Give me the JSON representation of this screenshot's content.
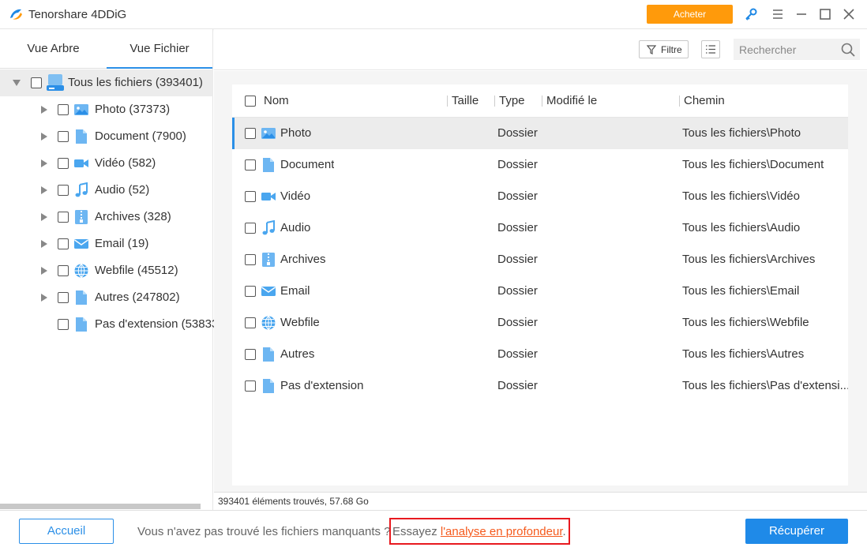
{
  "app": {
    "title": "Tenorshare 4DDiG",
    "buy_label": "Acheter"
  },
  "left": {
    "tabs": [
      {
        "label": "Vue Arbre"
      },
      {
        "label": "Vue Fichier"
      }
    ],
    "root": {
      "label": "Tous les fichiers (393401)"
    },
    "items": [
      {
        "label": "Photo (37373)",
        "icon": "image-icon"
      },
      {
        "label": "Document (7900)",
        "icon": "document-icon"
      },
      {
        "label": "Vidéo (582)",
        "icon": "video-icon"
      },
      {
        "label": "Audio (52)",
        "icon": "music-icon"
      },
      {
        "label": "Archives (328)",
        "icon": "archive-icon"
      },
      {
        "label": "Email (19)",
        "icon": "mail-icon"
      },
      {
        "label": "Webfile (45512)",
        "icon": "globe-icon"
      },
      {
        "label": "Autres (247802)",
        "icon": "document-icon"
      },
      {
        "label": "Pas d'extension (53833",
        "icon": "document-icon"
      }
    ]
  },
  "toolbar": {
    "filter_label": "Filtre",
    "search_placeholder": "Rechercher"
  },
  "table": {
    "columns": {
      "name": "Nom",
      "size": "Taille",
      "type": "Type",
      "modified": "Modifié le",
      "path": "Chemin"
    },
    "rows": [
      {
        "name": "Photo",
        "type": "Dossier",
        "path": "Tous les fichiers\\Photo",
        "icon": "image-icon"
      },
      {
        "name": "Document",
        "type": "Dossier",
        "path": "Tous les fichiers\\Document",
        "icon": "document-icon"
      },
      {
        "name": "Vidéo",
        "type": "Dossier",
        "path": "Tous les fichiers\\Vidéo",
        "icon": "video-icon"
      },
      {
        "name": "Audio",
        "type": "Dossier",
        "path": "Tous les fichiers\\Audio",
        "icon": "music-icon"
      },
      {
        "name": "Archives",
        "type": "Dossier",
        "path": "Tous les fichiers\\Archives",
        "icon": "archive-icon"
      },
      {
        "name": "Email",
        "type": "Dossier",
        "path": "Tous les fichiers\\Email",
        "icon": "mail-icon"
      },
      {
        "name": "Webfile",
        "type": "Dossier",
        "path": "Tous les fichiers\\Webfile",
        "icon": "globe-icon"
      },
      {
        "name": "Autres",
        "type": "Dossier",
        "path": "Tous les fichiers\\Autres",
        "icon": "document-icon"
      },
      {
        "name": "Pas d'extension",
        "type": "Dossier",
        "path": "Tous les fichiers\\Pas d'extensi...",
        "icon": "document-icon"
      }
    ]
  },
  "status": {
    "text": "393401 éléments trouvés, 57.68 Go"
  },
  "footer": {
    "home_label": "Accueil",
    "hint": "Vous n'avez pas trouvé les fichiers manquants ?",
    "try_prefix": "Essayez ",
    "try_link": "l'analyse en profondeur",
    "try_suffix": ".",
    "recover_label": "Récupérer"
  },
  "colors": {
    "accent": "#2b8fe7",
    "buy": "#ff9a0b",
    "highlight_border": "#e8191f",
    "link": "#f55a1d"
  }
}
